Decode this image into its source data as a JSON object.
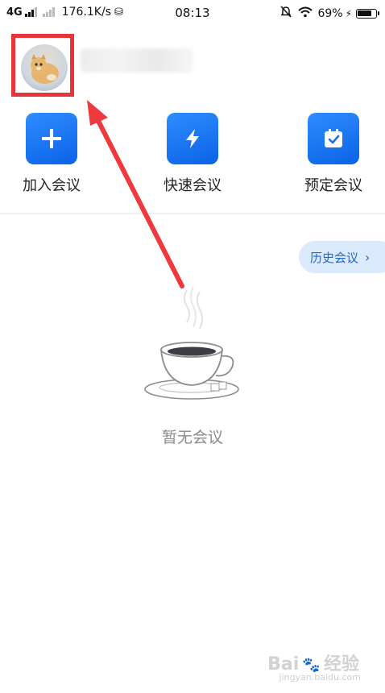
{
  "status_bar": {
    "network": "4G",
    "speed": "176.1K/s",
    "time": "08:13",
    "battery": "69%"
  },
  "actions": [
    {
      "label": "加入会议",
      "icon": "plus-icon"
    },
    {
      "label": "快速会议",
      "icon": "lightning-icon"
    },
    {
      "label": "预定会议",
      "icon": "calendar-check-icon"
    }
  ],
  "history_button": {
    "label": "历史会议",
    "chevron": "›"
  },
  "empty_state": {
    "text": "暂无会议"
  },
  "watermark": {
    "brand": "Bai",
    "brand_cn": "经验",
    "url": "jingyan.baidu.com"
  },
  "colors": {
    "accent": "#1a73f0",
    "highlight": "#e8333a",
    "pill_bg": "#dbeafc"
  }
}
